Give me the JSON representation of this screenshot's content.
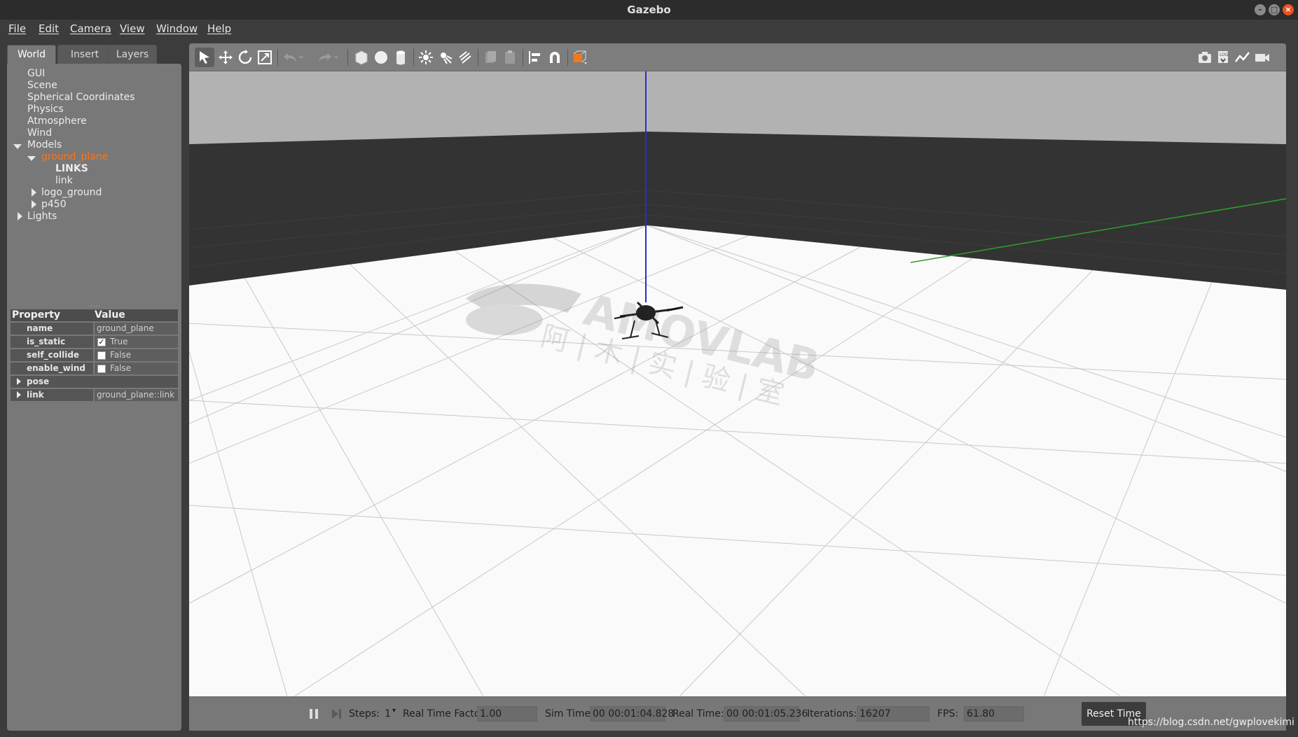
{
  "window": {
    "title": "Gazebo"
  },
  "menu": [
    "File",
    "Edit",
    "Camera",
    "View",
    "Window",
    "Help"
  ],
  "tabs": [
    "World",
    "Insert",
    "Layers"
  ],
  "tree": {
    "gui": "GUI",
    "scene": "Scene",
    "spherical": "Spherical Coordinates",
    "physics": "Physics",
    "atmosphere": "Atmosphere",
    "wind": "Wind",
    "models": "Models",
    "ground_plane": "ground_plane",
    "links_header": "LINKS",
    "link": "link",
    "logo_ground": "logo_ground",
    "p450": "p450",
    "lights": "Lights"
  },
  "properties": {
    "header_property": "Property",
    "header_value": "Value",
    "rows": [
      {
        "key": "name",
        "value": "ground_plane"
      },
      {
        "key": "is_static",
        "value": "True",
        "checked": true
      },
      {
        "key": "self_collide",
        "value": "False",
        "checked": false
      },
      {
        "key": "enable_wind",
        "value": "False",
        "checked": false
      },
      {
        "key": "pose",
        "value": ""
      },
      {
        "key": "link",
        "value": "ground_plane::link"
      }
    ]
  },
  "bottombar": {
    "steps_label": "Steps:",
    "steps_value": "1",
    "rtf_label": "Real Time Factor:",
    "rtf_value": "1.00",
    "sim_time_label": "Sim Time:",
    "sim_time_value": "00 00:01:04.828",
    "real_time_label": "Real Time:",
    "real_time_value": "00 00:01:05.236",
    "iterations_label": "Iterations:",
    "iterations_value": "16207",
    "fps_label": "FPS:",
    "fps_value": "61.80",
    "reset_label": "Reset Time"
  },
  "overlay_url": "https://blog.csdn.net/gwplovekimi",
  "colors": {
    "selected": "#f07822",
    "z_axis": "#2b2bd6",
    "y_axis": "#2da02d",
    "model_color": "#f07822"
  }
}
